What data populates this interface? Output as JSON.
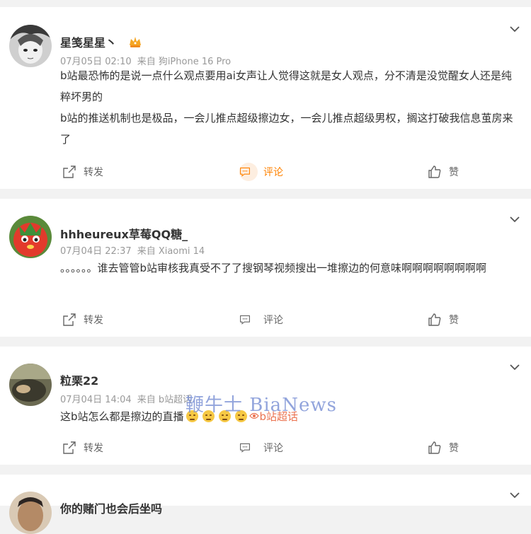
{
  "comments": [
    {
      "username": "星笺星星丶",
      "badge": "crown-badge",
      "time": "07月05日 02:10",
      "source": "来自 狗iPhone 16 Pro",
      "lines": [
        "b站最恐怖的是说一点什么观点要用ai女声让人觉得这就是女人观点，分不清是没觉醒女人还是纯粹坏男的",
        "b站的推送机制也是极品，一会儿推点超级擦边女，一会儿推点超级男权，搁这打破我信息茧房来了"
      ]
    },
    {
      "username": "hhheureux草莓QQ糖_",
      "time": "07月04日 22:37",
      "source": "来自 Xiaomi 14",
      "lines": [
        "。。。。。。谁去管管b站审核我真受不了了搜钢琴视频搜出一堆擦边的何意味啊啊啊啊啊啊啊啊"
      ]
    },
    {
      "username": "粒栗22",
      "time": "07月04日 14:04",
      "source": "来自 b站超话",
      "text": "这b站怎么都是擦边的直播",
      "emoji": "hush-emoji",
      "topic": "b站超话"
    },
    {
      "username": "你的赌门也会后坐吗"
    }
  ],
  "actions": {
    "share": "转发",
    "comment": "评论",
    "like": "赞"
  },
  "watermark": "鞭牛士 BiaNews",
  "colors": {
    "accent": "#ff8200",
    "topic": "#eb7350",
    "meta": "#999999"
  }
}
